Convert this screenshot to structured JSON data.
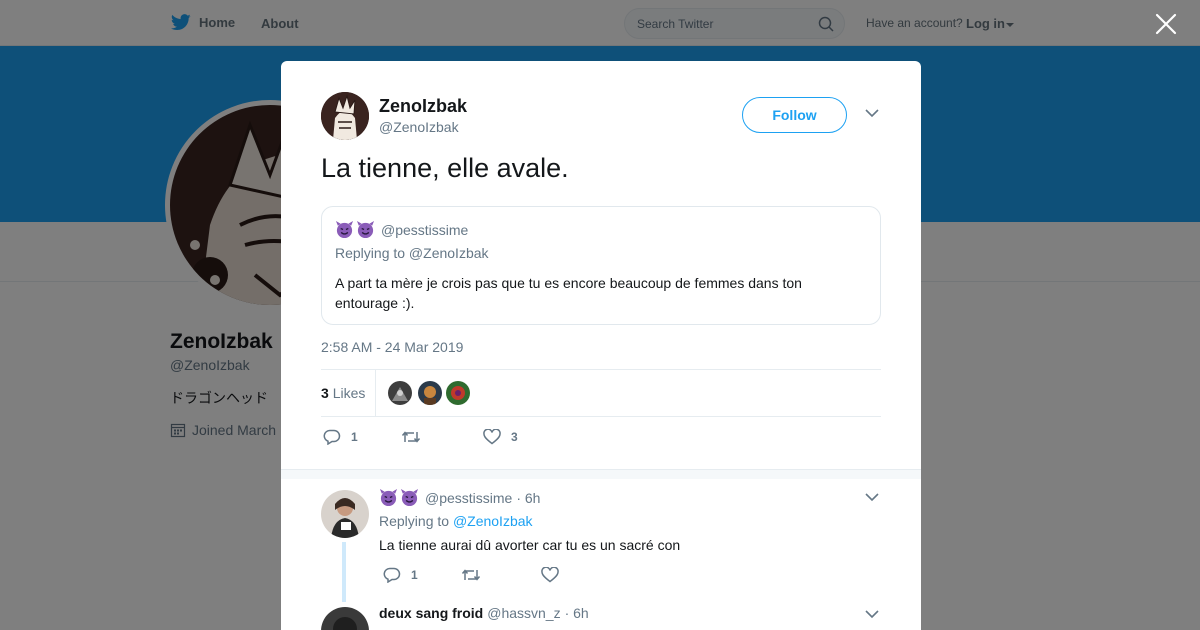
{
  "topbar": {
    "home_label": "Home",
    "about_label": "About",
    "search_placeholder": "Search Twitter",
    "account_prompt": "Have an account?",
    "login_label": "Log in"
  },
  "profile": {
    "name": "ZenoIzbak",
    "handle": "@ZenoIzbak",
    "bio": "ドラゴンヘッド",
    "joined": "Joined March"
  },
  "tweet": {
    "author_name": "ZenoIzbak",
    "author_handle": "@ZenoIzbak",
    "follow_label": "Follow",
    "text": "La tienne, elle avale.",
    "timestamp": "2:58 AM - 24 Mar 2019",
    "likes_count": "3",
    "likes_label": "Likes",
    "reply_count": "1",
    "retweet_count": "",
    "like_count": "3",
    "quote": {
      "handle": "@pesstissime",
      "replying_to": "Replying to @ZenoIzbak",
      "text": "A part ta mère je crois pas que tu es encore beaucoup de femmes dans ton entourage :)."
    }
  },
  "replies": [
    {
      "name": "",
      "handle": "@pesstissime",
      "time": "· 6h",
      "replying_prefix": "Replying to ",
      "replying_handle": "@ZenoIzbak",
      "text": "La tienne aurai dû avorter car tu es un sacré con",
      "reply_count": "1",
      "retweet_count": "",
      "like_count": ""
    },
    {
      "name": "deux sang froid",
      "handle": "@hassvn_z",
      "time": "· 6h"
    }
  ],
  "colors": {
    "brand_blue": "#1da1f2",
    "text_primary": "#14171a",
    "text_secondary": "#657786"
  }
}
